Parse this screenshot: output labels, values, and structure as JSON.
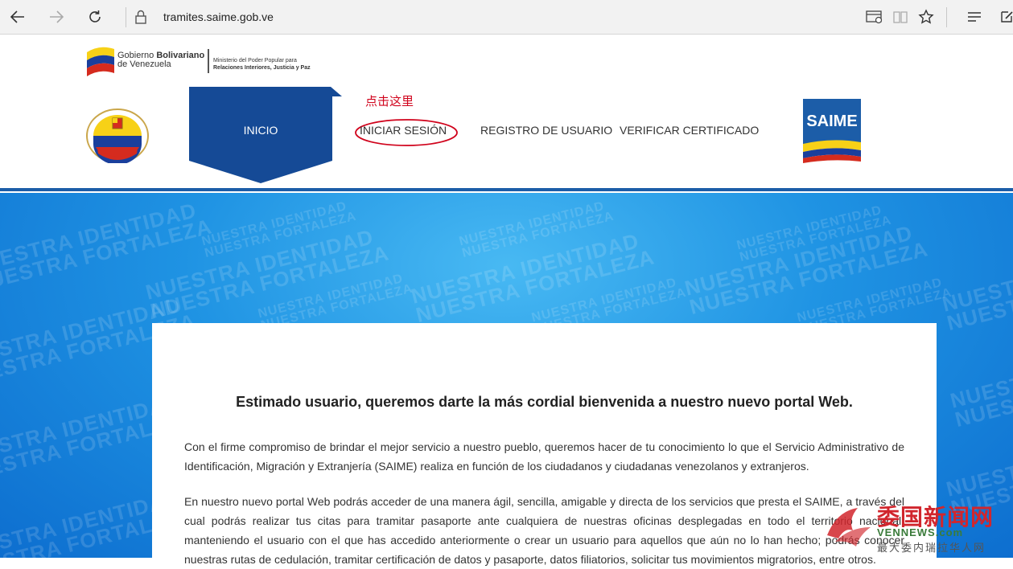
{
  "browser": {
    "url_domain": "tramites.saime.gob.ve"
  },
  "header": {
    "gov_line1_a": "Gobierno ",
    "gov_line1_b": "Bolivariano",
    "gov_line2": "de Venezuela",
    "ministry_line1": "Ministerio del Poder Popular para",
    "ministry_line2": "Relaciones Interiores, Justicia y Paz",
    "seal_text": "Ministerio del Poder Popular para Relaciones Interiores, Justicia y Paz",
    "saime_logo": "SAIME"
  },
  "nav": {
    "inicio": "INICIO",
    "iniciar_sesion": "INICIAR SESIÓN",
    "registro": "REGISTRO DE USUARIO",
    "verificar": "VERIFICAR CERTIFICADO"
  },
  "annotation": {
    "click_here": "点击这里"
  },
  "hero": {
    "watermark_line1": "NUESTRA IDENTIDAD",
    "watermark_line2": "NUESTRA FORTALEZA"
  },
  "content": {
    "welcome": "Estimado usuario, queremos darte la más cordial bienvenida a nuestro nuevo portal Web.",
    "paragraph1": "Con el firme compromiso de brindar el mejor servicio a nuestro pueblo, queremos hacer de tu conocimiento lo que el Servicio Administrativo de Identificación, Migración y Extranjería (SAIME) realiza en función de los ciudadanos y ciudadanas venezolanos y extranjeros.",
    "paragraph2": "En nuestro nuevo portal Web podrás acceder de una manera ágil, sencilla, amigable y directa de los servicios que presta el SAIME, a través del cual podrás realizar tus citas para tramitar pasaporte ante cualquiera de nuestras oficinas desplegadas en todo el territorio nacional, manteniendo el usuario con el que has accedido anteriormente o crear un usuario para aquellos que aún no lo han hecho; podrás conocer nuestras rutas de cedulación, tramitar certificación de datos y pasaporte, datos filiatorios, solicitar tus movimientos migratorios, entre otros."
  },
  "watermark_logo": {
    "title": "委国新闻网",
    "subtitle": "VENNEWS.com",
    "caption": "最大委内瑞拉华人网"
  },
  "colors": {
    "nav_blue": "#154a96",
    "annotation_red": "#d0021b",
    "hero_blue": "#1f93e3"
  }
}
